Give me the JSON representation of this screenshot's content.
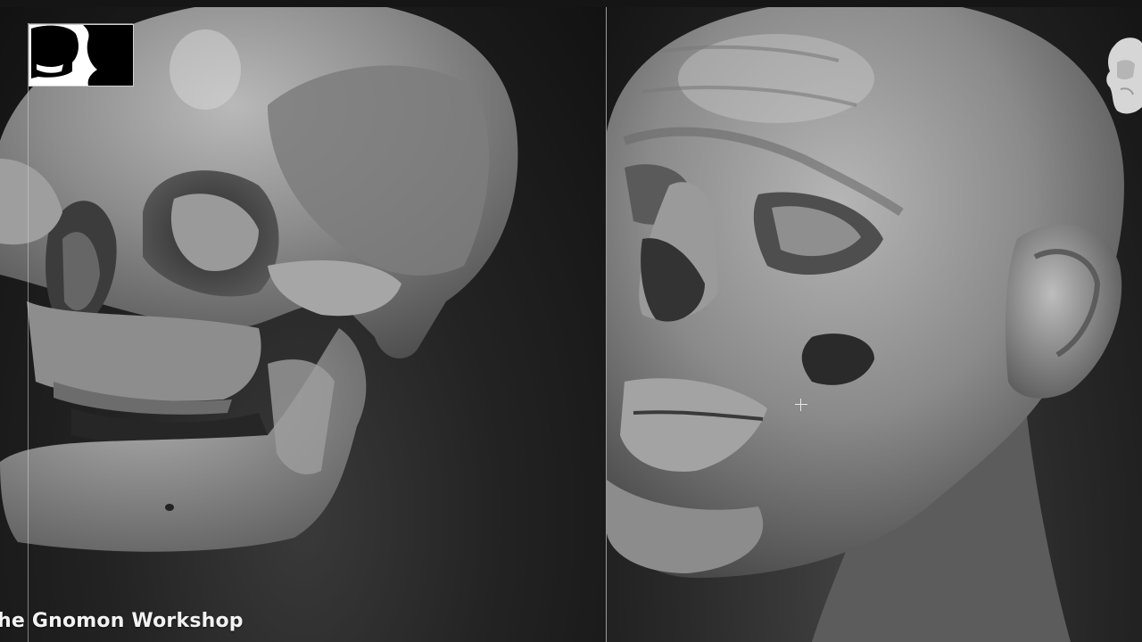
{
  "watermark": {
    "text": "he Gnomon Workshop"
  },
  "icons": {
    "thumbnail": "silhouette-thumbnail-icon",
    "navigation_cube": "head-navigation-gizmo-icon",
    "cursor": "crosshair-cursor-icon"
  },
  "colors": {
    "background": "#0c0c0c",
    "divider": "#9a9a9a",
    "model": "#8e8e8e",
    "watermark": "#f2f2f2"
  }
}
